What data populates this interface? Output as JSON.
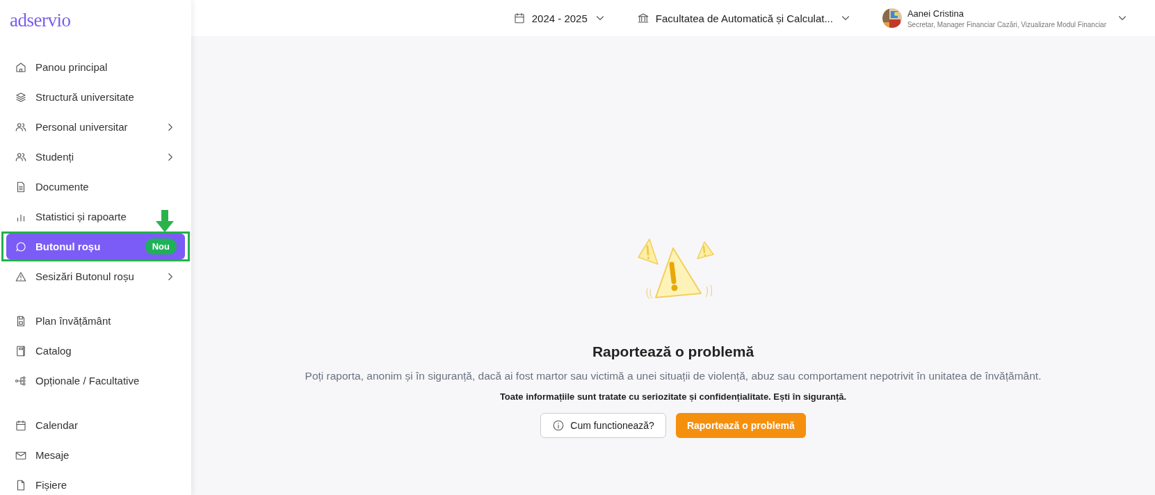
{
  "logo": "adservio",
  "sidebar": {
    "groups": [
      {
        "items": [
          {
            "label": "Panou principal",
            "selected": false,
            "expandable": false
          },
          {
            "label": "Structură universitate",
            "selected": false,
            "expandable": false
          },
          {
            "label": "Personal universitar",
            "selected": false,
            "expandable": true
          },
          {
            "label": "Studenți",
            "selected": false,
            "expandable": true
          },
          {
            "label": "Documente",
            "selected": false,
            "expandable": false
          },
          {
            "label": "Statistici și rapoarte",
            "selected": false,
            "expandable": false
          },
          {
            "label": "Butonul roșu",
            "selected": true,
            "expandable": false,
            "badge": "Nou",
            "highlighted": true
          },
          {
            "label": "Sesizări Butonul roșu",
            "selected": false,
            "expandable": true
          }
        ]
      },
      {
        "items": [
          {
            "label": "Plan învățământ",
            "selected": false,
            "expandable": false
          },
          {
            "label": "Catalog",
            "selected": false,
            "expandable": false
          },
          {
            "label": "Opționale / Facultative",
            "selected": false,
            "expandable": false
          }
        ]
      },
      {
        "items": [
          {
            "label": "Calendar",
            "selected": false,
            "expandable": false
          },
          {
            "label": "Mesaje",
            "selected": false,
            "expandable": false
          },
          {
            "label": "Fișiere",
            "selected": false,
            "expandable": false
          }
        ]
      }
    ]
  },
  "header": {
    "year": "2024 - 2025",
    "faculty": "Facultatea de Automatică și Calculat...",
    "user": {
      "name": "Aanei Cristina",
      "roles": "Secretar, Manager Financiar Cazări, Vizualizare Modul Financiar"
    }
  },
  "main": {
    "title": "Raportează o problemă",
    "description": "Poți raporta, anonim și în siguranță, dacă ai fost martor sau victimă a unei situații de violență, abuz sau comportament nepotrivit în unitatea de învățământ.",
    "note": "Toate informațiile sunt tratate cu seriozitate și confidențialitate. Ești în siguranță.",
    "buttons": [
      {
        "kind": "secondary",
        "label": "Cum functionează?"
      },
      {
        "kind": "primary",
        "label": "Raportează o problemă"
      }
    ]
  }
}
